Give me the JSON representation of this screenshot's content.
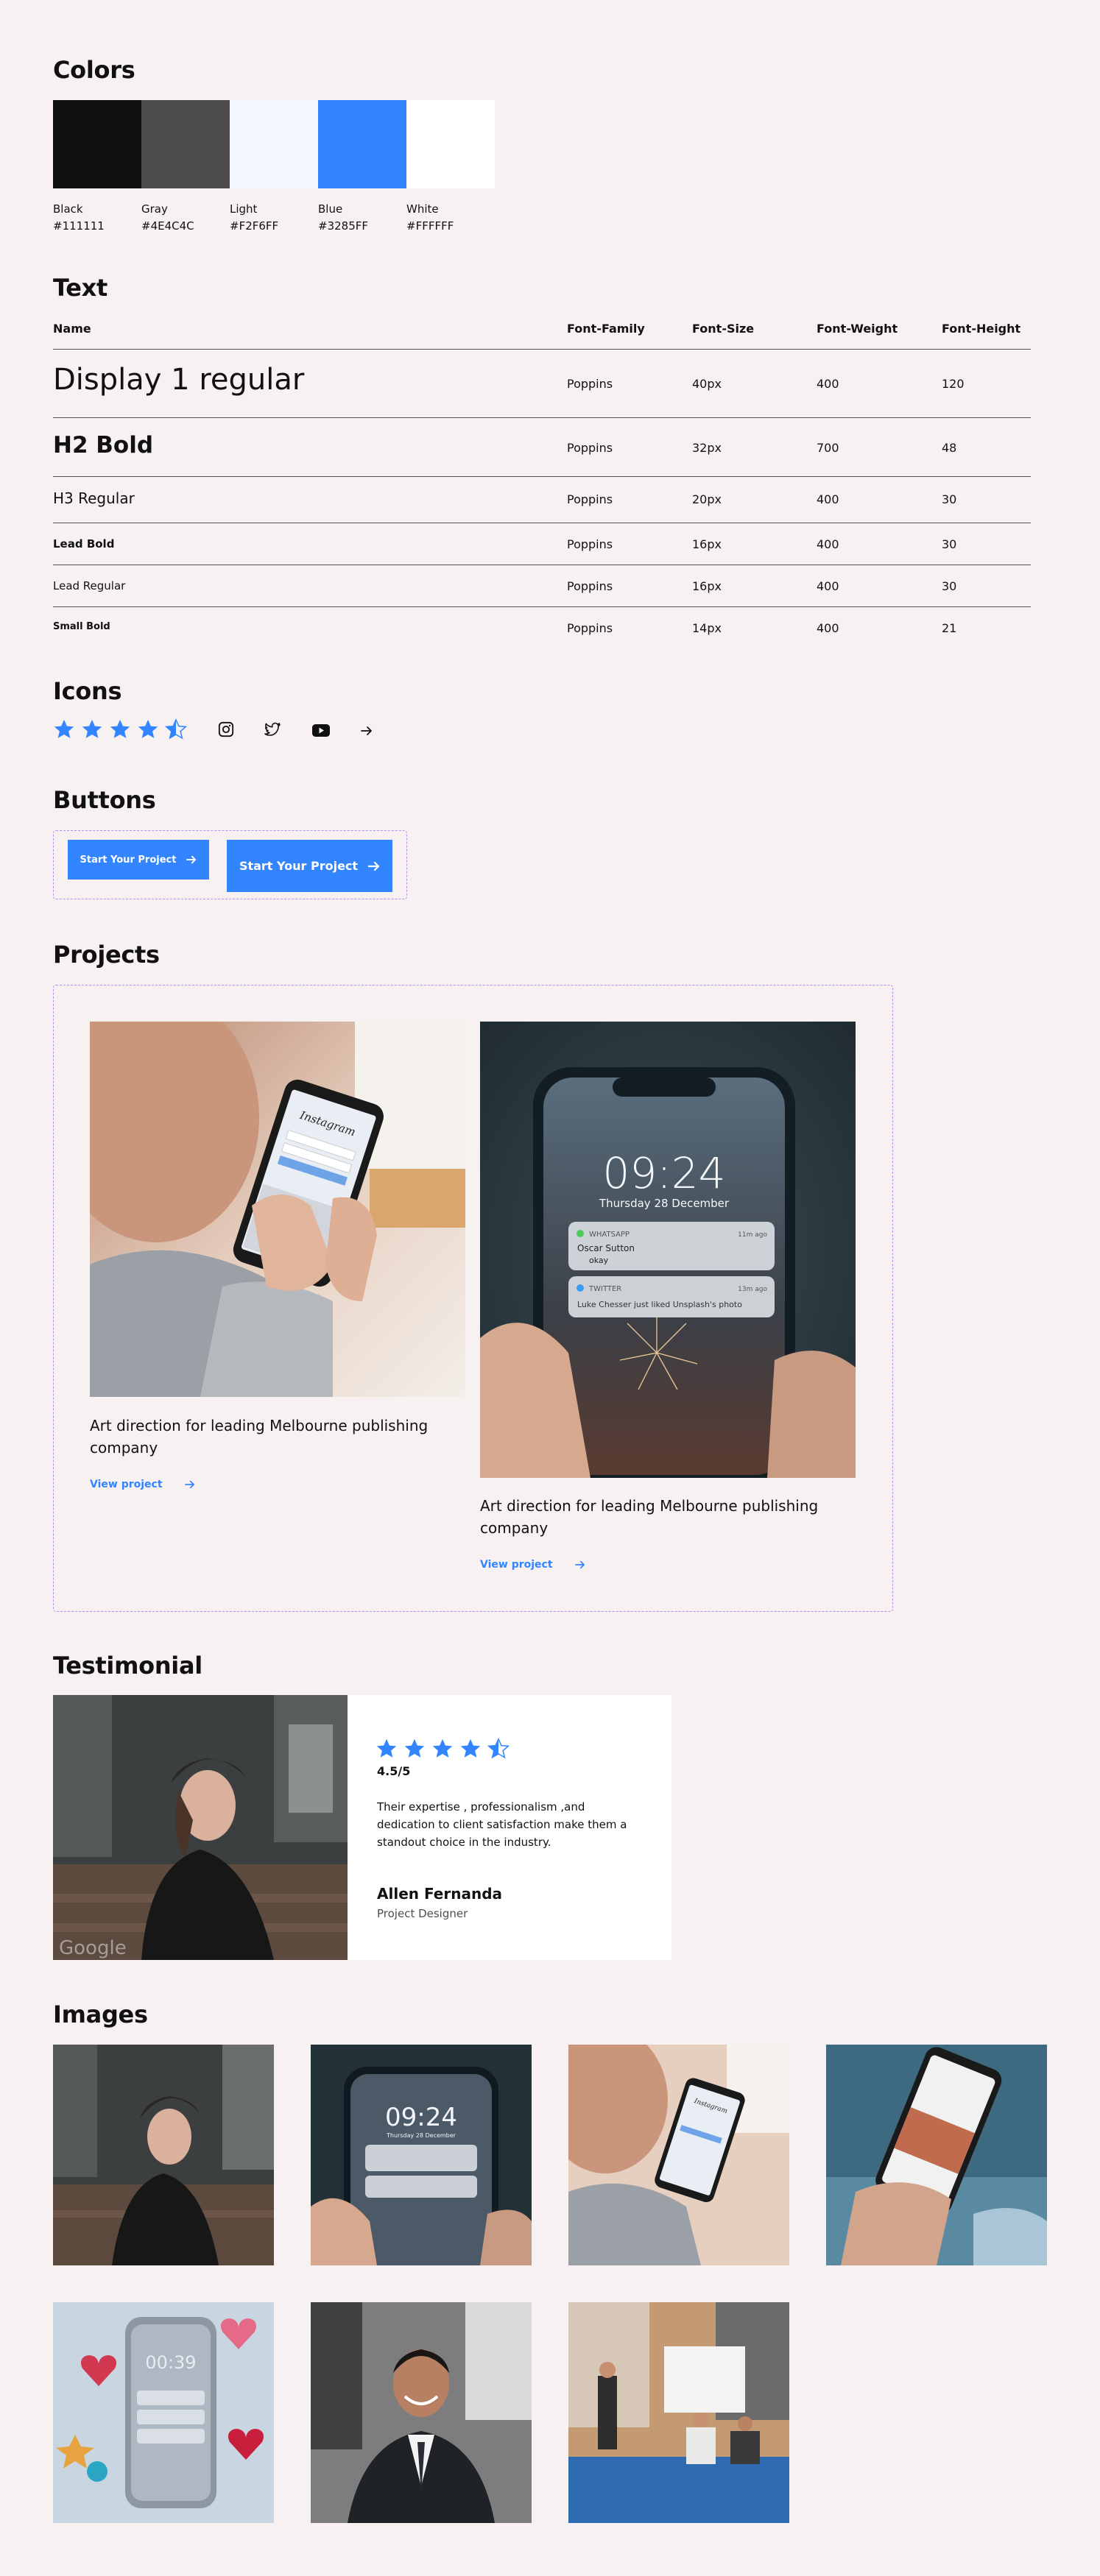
{
  "sections": {
    "colors": "Colors",
    "text": "Text",
    "icons": "Icons",
    "buttons": "Buttons",
    "projects": "Projects",
    "testimonial": "Testimonial",
    "images": "Images"
  },
  "colors": [
    {
      "name": "Black",
      "hex": "#111111",
      "value": "#111111"
    },
    {
      "name": "Gray",
      "hex": "#4E4C4C",
      "value": "#4E4C4C"
    },
    {
      "name": "Light",
      "hex": "#F2F6FF",
      "value": "#F2F6FF"
    },
    {
      "name": "Blue",
      "hex": "#3285FF",
      "value": "#3285FF"
    },
    {
      "name": "White",
      "hex": "#FFFFFF",
      "value": "#FFFFFF"
    }
  ],
  "typography": {
    "headers": [
      "Name",
      "Font-Family",
      "Font-Size",
      "Font-Weight",
      "Font-Height"
    ],
    "rows": [
      {
        "name": "Display 1 regular",
        "family": "Poppins",
        "size": "40px",
        "weight": "400",
        "height": "120"
      },
      {
        "name": "H2 Bold",
        "family": "Poppins",
        "size": "32px",
        "weight": "700",
        "height": "48"
      },
      {
        "name": "H3 Regular",
        "family": "Poppins",
        "size": "20px",
        "weight": "400",
        "height": "30"
      },
      {
        "name": "Lead Bold",
        "family": "Poppins",
        "size": "16px",
        "weight": "400",
        "height": "30"
      },
      {
        "name": "Lead Regular",
        "family": "Poppins",
        "size": "16px",
        "weight": "400",
        "height": "30"
      },
      {
        "name": "Small Bold",
        "family": "Poppins",
        "size": "14px",
        "weight": "400",
        "height": "21"
      }
    ]
  },
  "icons": [
    "star-icon",
    "star-icon",
    "star-icon",
    "star-icon",
    "half-star-icon",
    "instagram-icon",
    "twitter-icon",
    "youtube-icon",
    "arrow-right-icon"
  ],
  "buttons": {
    "small_label": "Start Your Project",
    "large_label": "Start Your Project"
  },
  "projects": [
    {
      "title": "Art direction for leading Melbourne publishing company",
      "link": "View project",
      "phone_app": "Instagram"
    },
    {
      "title": "Art direction for leading Melbourne publishing company",
      "link": "View project",
      "lock_time": "09:24",
      "lock_date": "Thursday 28 December",
      "notif1_app": "WHATSAPP",
      "notif1_time": "11m ago",
      "notif1_sender": "Oscar Sutton",
      "notif1_msg": "okay",
      "notif2_app": "TWITTER",
      "notif2_time": "13m ago",
      "notif2_msg": "Luke Chesser just liked Unsplash's photo"
    }
  ],
  "testimonial": {
    "rating": "4.5/5",
    "quote": "Their expertise , professionalism ,and dedication  to client satisfaction make them a standout choice in the industry.",
    "author": "Allen Fernanda",
    "role": "Project Designer",
    "watermark": "Google"
  },
  "images": {
    "thumb_lock_time": "09:24",
    "thumb_lock_date": "Thursday 28 December",
    "thumb_phone_app": "Instagram",
    "thumb_hearts_time": "00:39"
  },
  "accent": "#3285FF",
  "dashed_border": "#b78cf4"
}
